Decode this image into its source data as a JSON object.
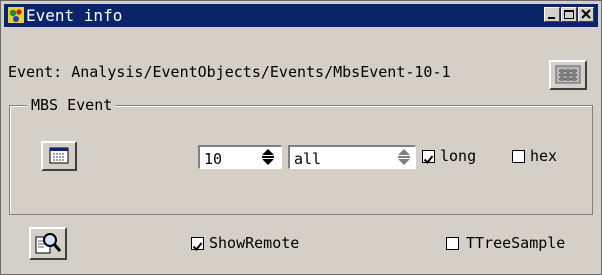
{
  "window": {
    "title": "Event info",
    "buttons": [
      "minimize",
      "maximize",
      "close"
    ]
  },
  "event": {
    "label": "Event:",
    "path": "Analysis/EventObjects/Events/MbsEvent-10-1"
  },
  "group": {
    "title": "MBS Event",
    "count_value": "10",
    "subevent_value": "all",
    "long_label": "long",
    "long_checked": true,
    "hex_label": "hex",
    "hex_checked": false
  },
  "bottom": {
    "show_remote_label": "ShowRemote",
    "show_remote_checked": true,
    "ttree_label": "TTreeSample",
    "ttree_checked": false
  },
  "icons": {
    "title_app": "go4-app-icon",
    "mbs_button": "mbs-icon",
    "table_button": "table-icon",
    "inspect_button": "magnifier-document-icon"
  }
}
